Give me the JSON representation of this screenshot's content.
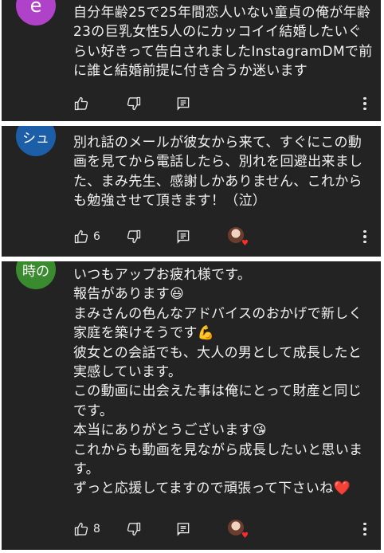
{
  "comments": [
    {
      "avatar_text": "e",
      "avatar_color": "#b042c9",
      "text": "自分年齢25で25年間恋人いない童貞の俺が年齢23の巨乳女性5人のにカッコイイ結婚したいぐらい好きって告白されましたInstagramDMで前に誰と結婚前提に付き合うか迷います",
      "likes": ""
    },
    {
      "avatar_text": "シュ",
      "avatar_color": "#1c5fa8",
      "text": "別れ話のメールが彼女から来て、すぐにこの動画を見てから電話したら、別れを回避出来ました、まみ先生、感謝しかありません、これからも勉強させて頂きます！（泣）",
      "likes": "6"
    },
    {
      "avatar_text": "時の",
      "avatar_color": "#3a8a2f",
      "text": "いつもアップお疲れ様です。\n報告があります😃\nまみさんの色んなアドバイスのおかげで新しく家庭を築けそうです💪\n彼女との会話でも、大人の男として成長したと実感しています。\nこの動画に出会えた事は俺にとって財産と同じです。\n本当にありがとうございます😘\nこれからも動画を見ながら成長したいと思います。\nずっと応援してますので頑張って下さいね❤️",
      "likes": "8"
    }
  ],
  "icons": {
    "like": "thumb-up-icon",
    "dislike": "thumb-down-icon",
    "reply": "reply-icon",
    "creator_heart": "creator-heart-icon",
    "more": "more-vert-icon"
  },
  "colors": {
    "card_bg": "#232323",
    "text": "#f1f1f1",
    "heart": "#ff2a2a"
  }
}
